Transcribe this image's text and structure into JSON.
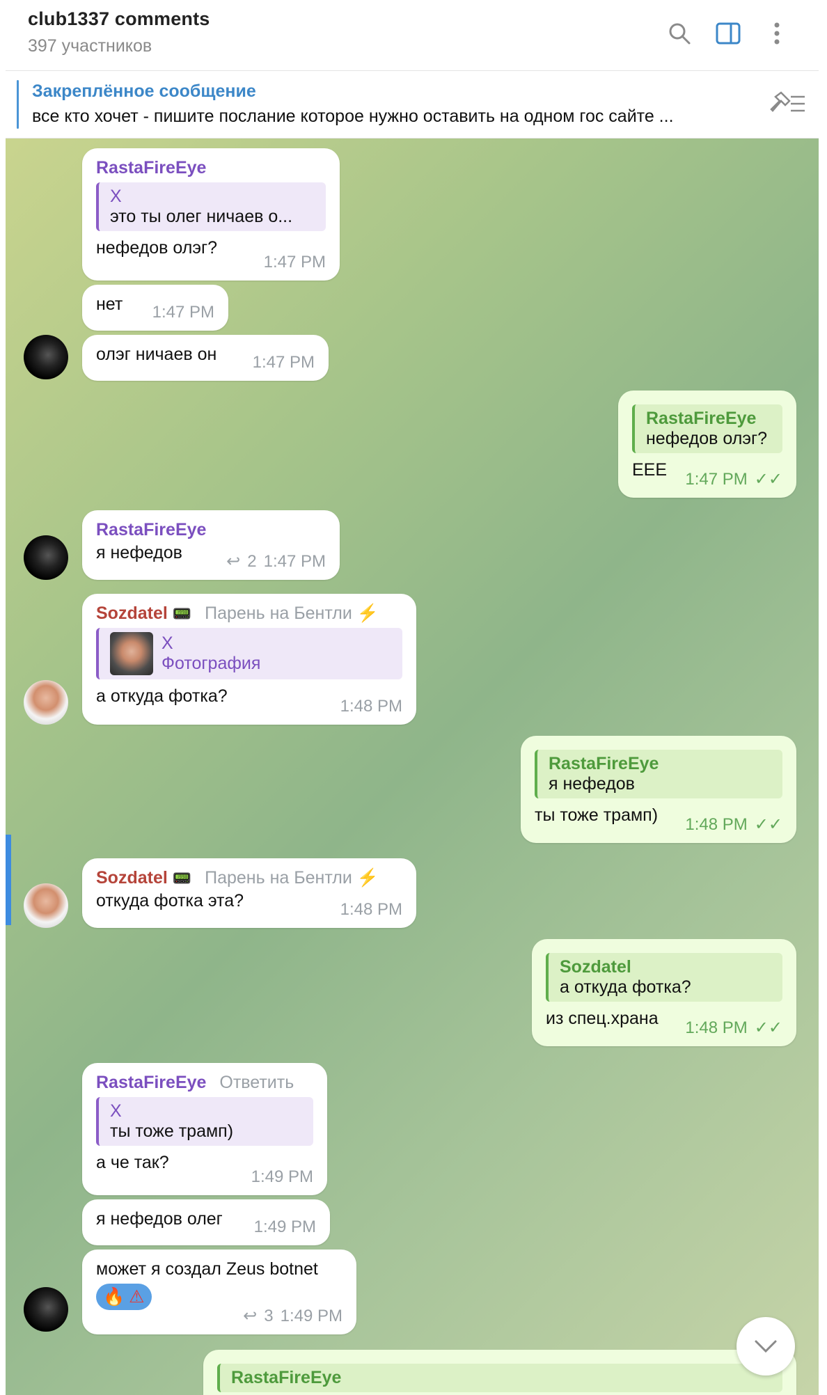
{
  "header": {
    "title": "club1337 comments",
    "members": "397 участников",
    "icons": [
      "search-icon",
      "sidebar-icon",
      "more-icon"
    ]
  },
  "pinned": {
    "title": "Закреплённое сообщение",
    "text": "все кто хочет - пишите послание которое нужно оставить на одном гос сайте ..."
  },
  "messages": {
    "m1": {
      "name": "RastaFireEye",
      "reply_name": "X",
      "reply_text": "это ты олег ничаев о...",
      "text": "нефедов олэг?",
      "time": "1:47 PM"
    },
    "m2": {
      "text": "нет",
      "time": "1:47 PM"
    },
    "m3": {
      "text": "олэг ничаев он",
      "time": "1:47 PM"
    },
    "m4": {
      "reply_name": "RastaFireEye",
      "reply_text": "нефедов олэг?",
      "text": "ЕЕЕ",
      "time": "1:47 PM"
    },
    "m5": {
      "name": "RastaFireEye",
      "text": "я нефедов",
      "replies": "2",
      "time": "1:47 PM"
    },
    "m6": {
      "name": "Sozdatel",
      "rank": "Парень на Бентли",
      "reply_name": "X",
      "reply_text": "Фотография",
      "text": "а откуда фотка?",
      "time": "1:48 PM"
    },
    "m7": {
      "reply_name": "RastaFireEye",
      "reply_text": "я нефедов",
      "text": "ты тоже трамп)",
      "time": "1:48 PM"
    },
    "m8": {
      "name": "Sozdatel",
      "rank": "Парень на Бентли",
      "text": "откуда фотка эта?",
      "time": "1:48 PM"
    },
    "m9": {
      "reply_name": "Sozdatel",
      "reply_text": "а откуда фотка?",
      "text": "из спец.храна",
      "time": "1:48 PM"
    },
    "m10": {
      "name": "RastaFireEye",
      "action": "Ответить",
      "reply_name": "X",
      "reply_text": "ты тоже трамп)",
      "text": "а че так?",
      "time": "1:49 PM"
    },
    "m11": {
      "text": "я нефедов олег",
      "time": "1:49 PM"
    },
    "m12": {
      "text": "может я создал Zeus botnet",
      "reactions": [
        "🔥",
        "⚠"
      ],
      "replies": "3",
      "time": "1:49 PM"
    },
    "m13": {
      "reply_name": "RastaFireEye"
    }
  },
  "colors": {
    "accent_blue": "#3c87c8",
    "name_purple": "#7b4fbf",
    "name_red": "#b5443a",
    "name_green": "#4e9a3c",
    "outgoing_bubble": "#effdde",
    "incoming_bubble": "#ffffff"
  }
}
